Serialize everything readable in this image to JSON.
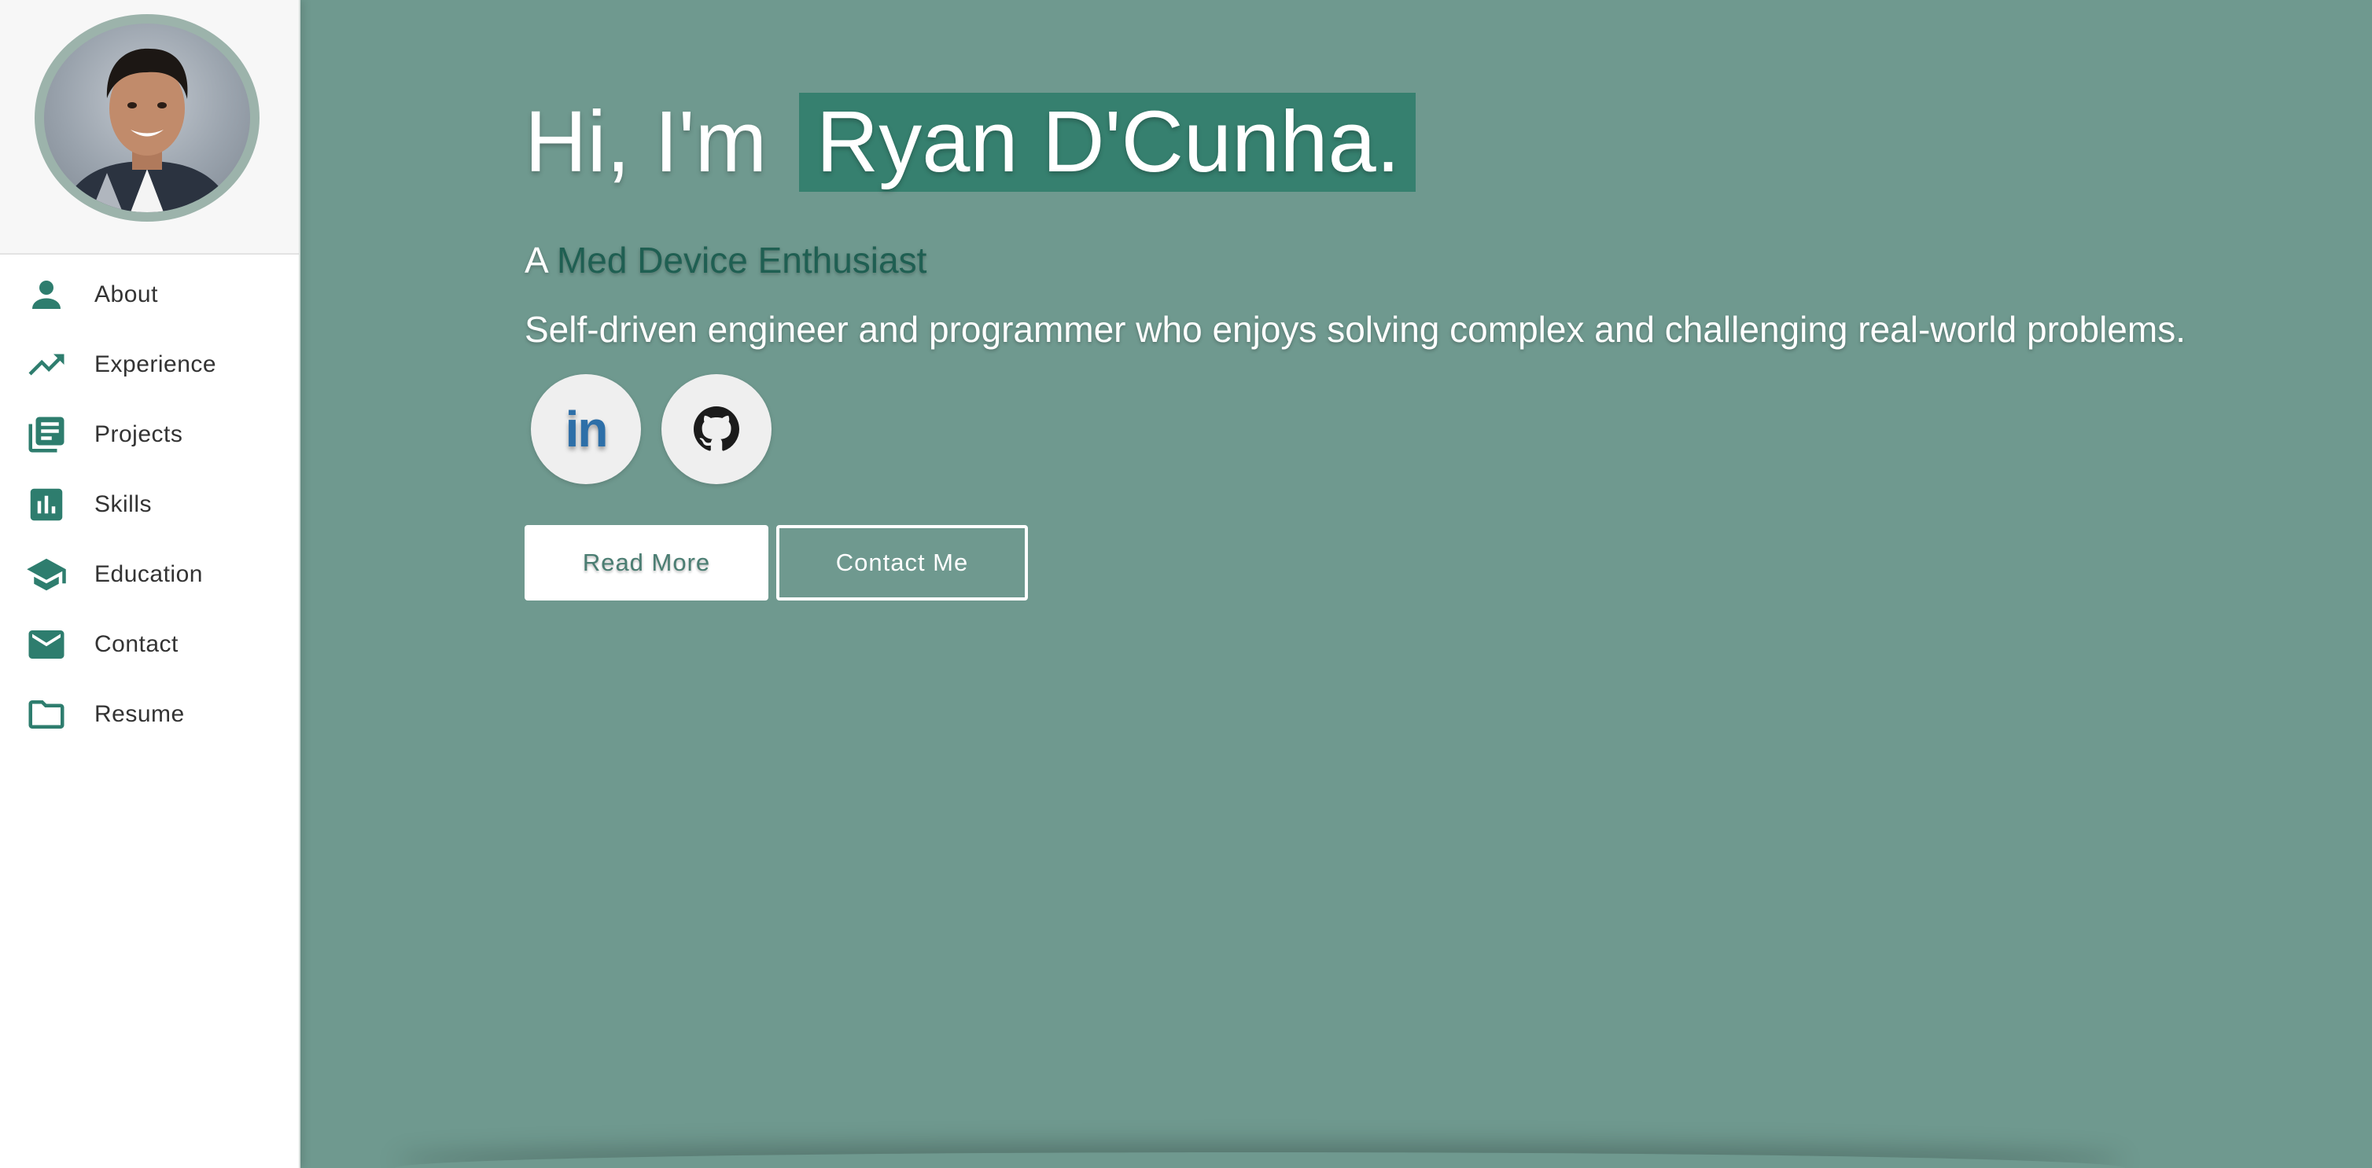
{
  "sidebar": {
    "avatar_alt": "Ryan D'Cunha profile photo",
    "items": [
      {
        "label": "About",
        "icon": "person-icon"
      },
      {
        "label": "Experience",
        "icon": "trending-up-icon"
      },
      {
        "label": "Projects",
        "icon": "library-books-icon"
      },
      {
        "label": "Skills",
        "icon": "bar-chart-icon"
      },
      {
        "label": "Education",
        "icon": "graduation-cap-icon"
      },
      {
        "label": "Contact",
        "icon": "mail-icon"
      },
      {
        "label": "Resume",
        "icon": "folder-icon"
      }
    ]
  },
  "hero": {
    "greeting": "Hi, I'm",
    "name": "Ryan D'Cunha.",
    "subtitle_prefix": "A",
    "subtitle_role": "Med Device Enthusiast",
    "description": "Self-driven engineer and programmer who enjoys solving complex and challenging real-world problems.",
    "socials": [
      {
        "name": "LinkedIn",
        "icon": "linkedin-icon",
        "mark": "in"
      },
      {
        "name": "GitHub",
        "icon": "github-icon"
      }
    ],
    "buttons": {
      "read_more": "Read More",
      "contact_me": "Contact Me"
    }
  },
  "colors": {
    "accent": "#2e7d6e",
    "hero_bg": "#6f998f",
    "name_highlight": "#36806f",
    "role_text": "#1f5f52"
  }
}
